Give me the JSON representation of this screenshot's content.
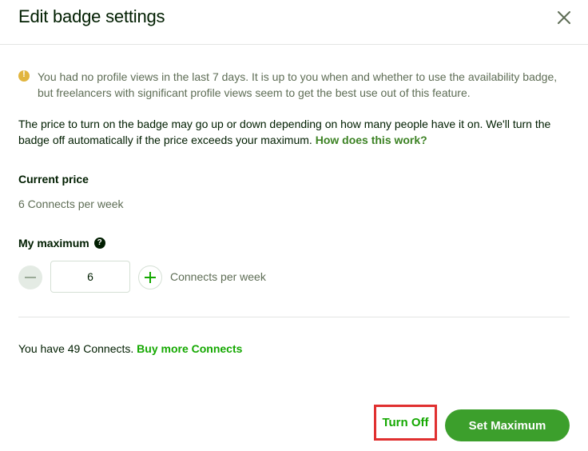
{
  "dialog": {
    "title": "Edit badge settings",
    "close_icon": "close-icon"
  },
  "notice": {
    "icon": "warning-icon",
    "icon_color": "#e1b53f",
    "text": "You had no profile views in the last 7 days. It is up to you when and whether to use the availability badge, but freelancers with significant profile views seem to get the best use out of this feature."
  },
  "description": {
    "text": "The price to turn on the badge may go up or down depending on how many people have it on. We'll turn the badge off automatically if the price exceeds your maximum.",
    "link": "How does this work?"
  },
  "current_price": {
    "label": "Current price",
    "value": "6 Connects per week"
  },
  "maximum": {
    "label": "My maximum",
    "help_icon": "question-circle-icon",
    "help_glyph": "?",
    "value": "6",
    "unit": "Connects per week"
  },
  "connects": {
    "text": "You have 49 Connects.",
    "link": "Buy more Connects"
  },
  "buttons": {
    "turn_off": "Turn Off",
    "set_maximum": "Set Maximum"
  },
  "colors": {
    "accent_green": "#14a800",
    "button_green": "#3c9f2c",
    "highlight_red": "#e03030"
  }
}
